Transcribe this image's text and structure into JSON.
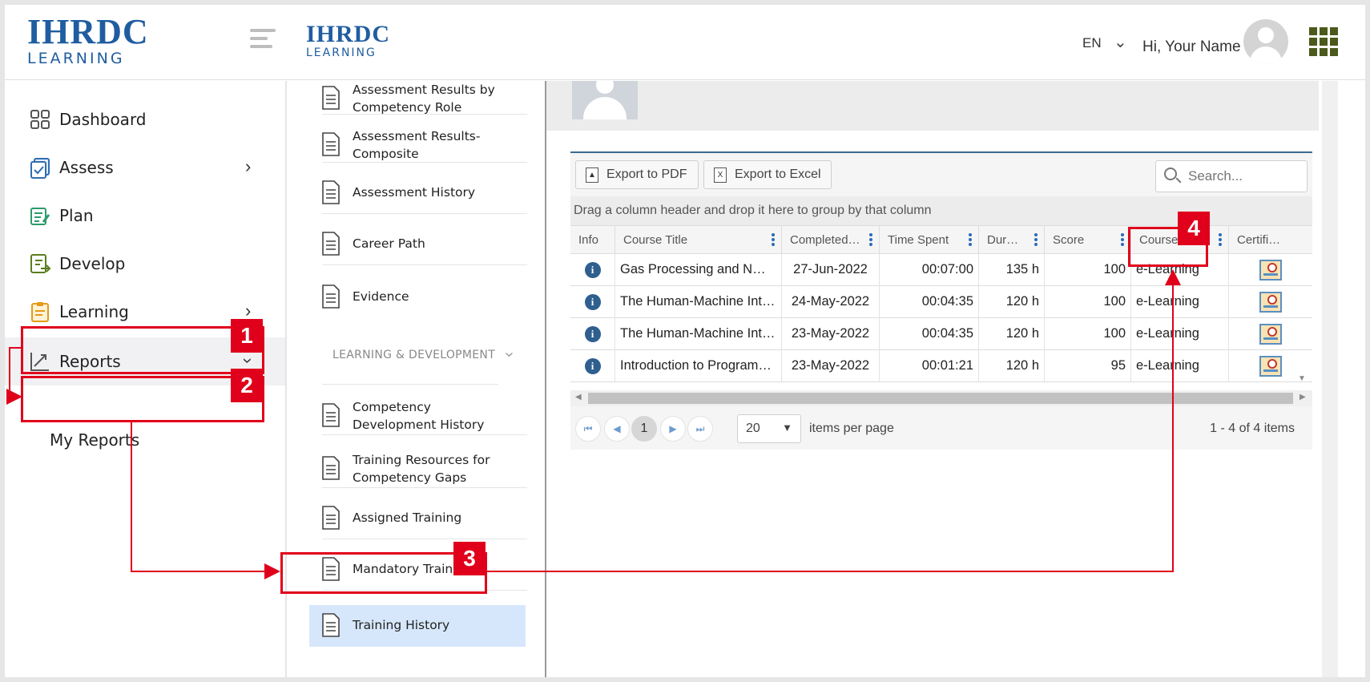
{
  "header": {
    "logo_line1": "IHRDC",
    "logo_line2": "LEARNING",
    "language": "EN",
    "greeting": "Hi, Your Name"
  },
  "sidebar": {
    "items": [
      {
        "label": "Dashboard",
        "icon": "dashboard-icon"
      },
      {
        "label": "Assess",
        "icon": "assess-icon"
      },
      {
        "label": "Plan",
        "icon": "plan-icon"
      },
      {
        "label": "Develop",
        "icon": "develop-icon"
      },
      {
        "label": "Learning",
        "icon": "learning-icon"
      },
      {
        "label": "Reports",
        "icon": "reports-icon"
      }
    ],
    "submenu": {
      "label": "My Reports"
    }
  },
  "report_list": {
    "items": [
      {
        "label": "Assessment Results by Competency Role"
      },
      {
        "label": "Assessment Results-Composite"
      },
      {
        "label": "Assessment History"
      },
      {
        "label": "Career Path"
      },
      {
        "label": "Evidence"
      },
      {
        "label": "Competency Development History"
      },
      {
        "label": "Training Resources for Competency Gaps"
      },
      {
        "label": "Assigned Training"
      },
      {
        "label": "Mandatory Training"
      },
      {
        "label": "Training History"
      }
    ],
    "section_heading": "LEARNING & DEVELOPMENT"
  },
  "grid": {
    "export_pdf": "Export to PDF",
    "export_excel": "Export to Excel",
    "search_placeholder": "Search...",
    "group_hint": "Drag a column header and drop it here to group by that column",
    "columns": [
      "Info",
      "Course Title",
      "Completed…",
      "Time Spent",
      "Dur…",
      "Score",
      "Course T…",
      "Certifi…"
    ],
    "rows": [
      {
        "title": "Gas Processing and N…",
        "completed": "27-Jun-2022",
        "time_spent": "00:07:00",
        "duration": "135 h",
        "score": "100",
        "course_type": "e-Learning"
      },
      {
        "title": "The Human-Machine Int…",
        "completed": "24-May-2022",
        "time_spent": "00:04:35",
        "duration": "120 h",
        "score": "100",
        "course_type": "e-Learning"
      },
      {
        "title": "The Human-Machine Int…",
        "completed": "23-May-2022",
        "time_spent": "00:04:35",
        "duration": "120 h",
        "score": "100",
        "course_type": "e-Learning"
      },
      {
        "title": "Introduction to Program…",
        "completed": "23-May-2022",
        "time_spent": "00:01:21",
        "duration": "120 h",
        "score": "95",
        "course_type": "e-Learning"
      }
    ],
    "pager": {
      "current_page": "1",
      "page_size": "20",
      "items_per_page": "items per page",
      "info": "1 - 4 of 4 items"
    }
  },
  "annotations": {
    "badges": [
      "1",
      "2",
      "3",
      "4"
    ],
    "color": "#e0001b"
  }
}
